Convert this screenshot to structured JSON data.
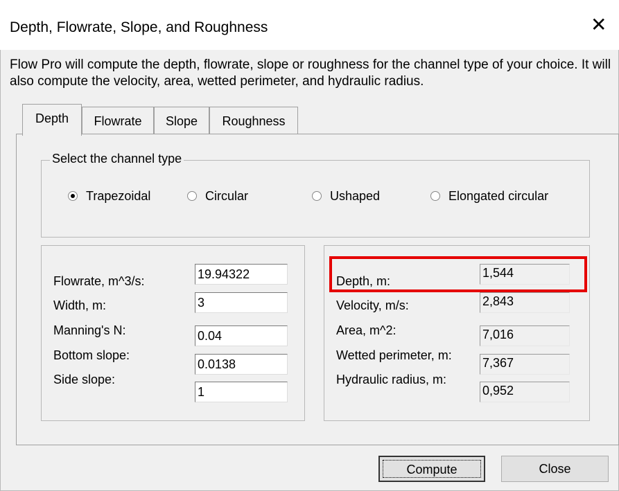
{
  "window": {
    "title": "Depth, Flowrate, Slope, and Roughness",
    "close_glyph": "✕"
  },
  "description": "Flow Pro will compute the depth, flowrate, slope or roughness for the channel type of your choice.  It will also compute the velocity, area, wetted perimeter, and hydraulic radius.",
  "tabs": [
    {
      "label": "Depth",
      "active": true
    },
    {
      "label": "Flowrate",
      "active": false
    },
    {
      "label": "Slope",
      "active": false
    },
    {
      "label": "Roughness",
      "active": false
    }
  ],
  "channel_type": {
    "group_label": "Select the channel type",
    "options": [
      {
        "label": "Trapezoidal",
        "selected": true
      },
      {
        "label": "Circular",
        "selected": false
      },
      {
        "label": "Ushaped",
        "selected": false
      },
      {
        "label": "Elongated circular",
        "selected": false
      }
    ]
  },
  "inputs": [
    {
      "label": "Flowrate, m^3/s:",
      "value": "19.94322"
    },
    {
      "label": "Width, m:",
      "value": "3"
    },
    {
      "label": "Manning's N:",
      "value": "0.04"
    },
    {
      "label": "Bottom slope:",
      "value": "0.0138"
    },
    {
      "label": "Side slope:",
      "value": "1"
    }
  ],
  "outputs": [
    {
      "label": "Depth, m:",
      "value": "1,544",
      "highlighted": true
    },
    {
      "label": "Velocity, m/s:",
      "value": "2,843"
    },
    {
      "label": "Area, m^2:",
      "value": "7,016"
    },
    {
      "label": "Wetted perimeter, m:",
      "value": "7,367"
    },
    {
      "label": "Hydraulic radius, m:",
      "value": "0,952"
    }
  ],
  "buttons": {
    "compute": "Compute",
    "close": "Close"
  },
  "colors": {
    "highlight": "#e50000",
    "dialog_bg": "#f0f0f0"
  }
}
